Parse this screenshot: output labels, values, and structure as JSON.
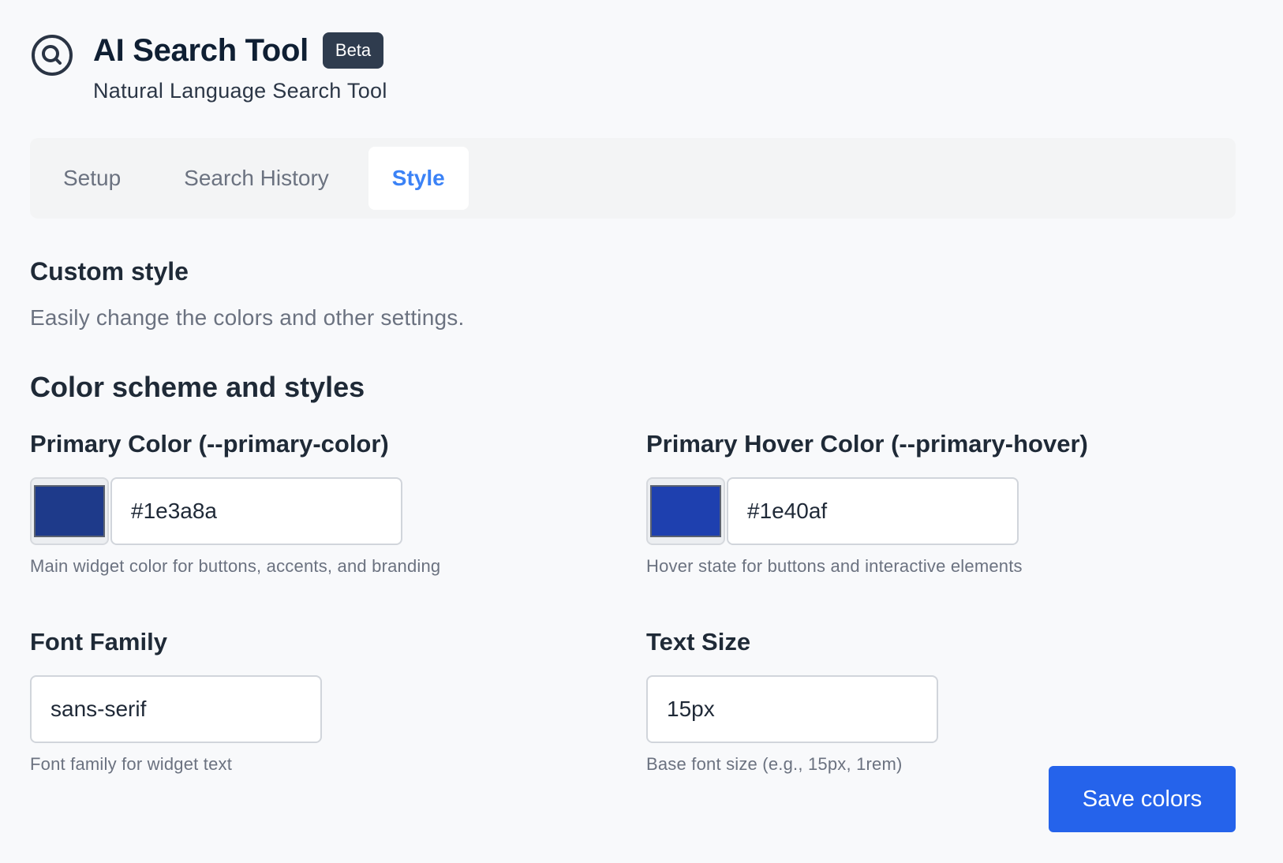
{
  "header": {
    "title": "AI Search Tool",
    "badge": "Beta",
    "subtitle": "Natural Language Search Tool",
    "logo_icon": "search-circle-icon"
  },
  "tabs": [
    {
      "label": "Setup",
      "active": false
    },
    {
      "label": "Search History",
      "active": false
    },
    {
      "label": "Style",
      "active": true
    }
  ],
  "custom_style": {
    "title": "Custom style",
    "description": "Easily change the colors and other settings."
  },
  "color_scheme": {
    "title": "Color scheme and styles",
    "primary_color": {
      "label": "Primary Color (--primary-color)",
      "value": "#1e3a8a",
      "help": "Main widget color for buttons, accents, and branding"
    },
    "primary_hover": {
      "label": "Primary Hover Color (--primary-hover)",
      "value": "#1e40af",
      "help": "Hover state for buttons and interactive elements"
    },
    "font_family": {
      "label": "Font Family",
      "value": "sans-serif",
      "help": "Font family for widget text"
    },
    "text_size": {
      "label": "Text Size",
      "value": "15px",
      "help": "Base font size (e.g., 15px, 1rem)"
    }
  },
  "actions": {
    "save_label": "Save colors"
  },
  "colors": {
    "accent": "#3b82f6",
    "button": "#2563eb",
    "badge_bg": "#2f3c4e"
  }
}
